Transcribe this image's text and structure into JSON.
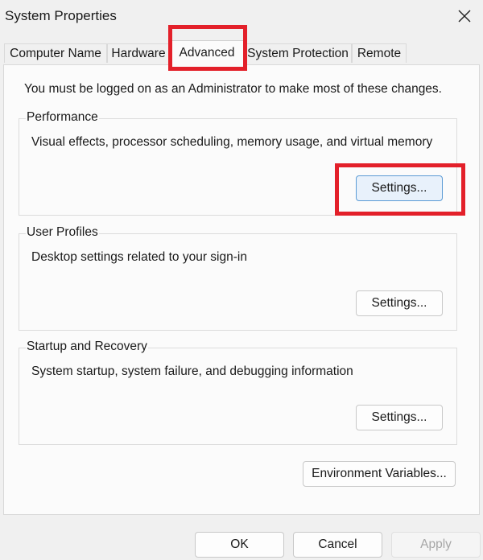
{
  "window": {
    "title": "System Properties",
    "close_icon": "close-icon"
  },
  "tabs": [
    {
      "label": "Computer Name",
      "active": false
    },
    {
      "label": "Hardware",
      "active": false
    },
    {
      "label": "Advanced",
      "active": true
    },
    {
      "label": "System Protection",
      "active": false
    },
    {
      "label": "Remote",
      "active": false
    }
  ],
  "advanced": {
    "admin_note": "You must be logged on as an Administrator to make most of these changes.",
    "performance": {
      "title": "Performance",
      "description": "Visual effects, processor scheduling, memory usage, and virtual memory",
      "settings_label": "Settings..."
    },
    "user_profiles": {
      "title": "User Profiles",
      "description": "Desktop settings related to your sign-in",
      "settings_label": "Settings..."
    },
    "startup_recovery": {
      "title": "Startup and Recovery",
      "description": "System startup, system failure, and debugging information",
      "settings_label": "Settings..."
    },
    "env_vars_label": "Environment Variables..."
  },
  "footer": {
    "ok_label": "OK",
    "cancel_label": "Cancel",
    "apply_label": "Apply"
  },
  "colors": {
    "highlight": "#e3202a",
    "focus_border": "#5b9bd5"
  }
}
